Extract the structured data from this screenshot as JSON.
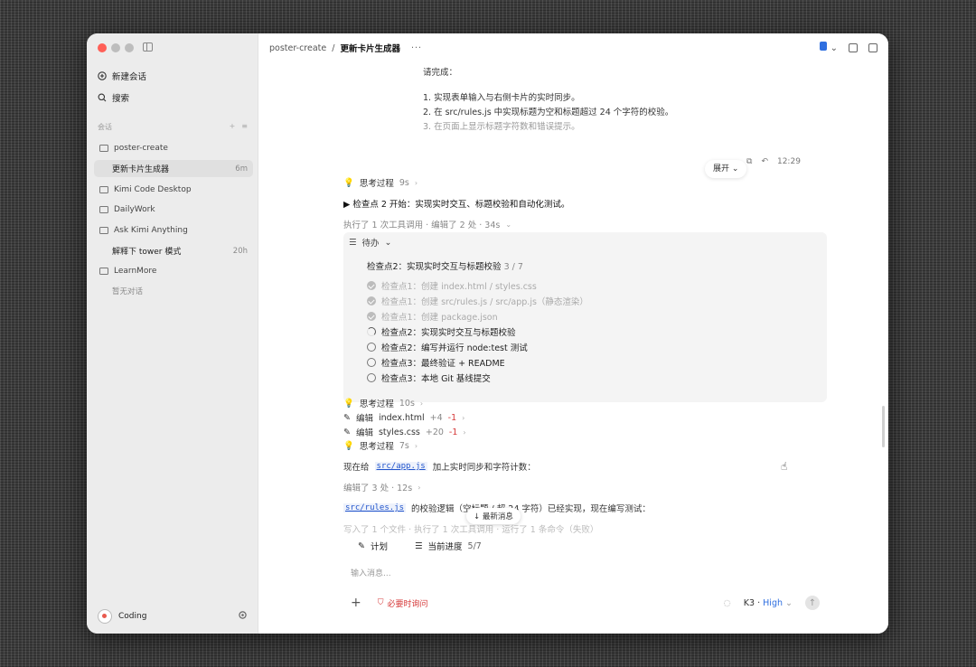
{
  "sidebar": {
    "new_chat": "新建会话",
    "search": "搜索",
    "section_label": "会话",
    "projects": [
      {
        "name": "poster-create",
        "chats": [
          {
            "title": "更新卡片生成器",
            "time": "6m",
            "active": true
          }
        ]
      },
      {
        "name": "Kimi Code Desktop",
        "chats": []
      },
      {
        "name": "DailyWork",
        "chats": []
      },
      {
        "name": "Ask Kimi Anything",
        "chats": [
          {
            "title": "解释下 tower 模式",
            "time": "20h",
            "active": false
          }
        ]
      },
      {
        "name": "LearnMore",
        "chats": [],
        "empty_text": "暂无对话"
      }
    ],
    "user": {
      "name": "Coding"
    }
  },
  "topbar": {
    "project": "poster-create",
    "separator": "/",
    "title": "更新卡片生成器",
    "more": "···"
  },
  "user_message": {
    "intro": "请完成：",
    "lines": [
      "1. 实现表单输入与右侧卡片的实时同步。",
      "2. 在 src/rules.js 中实现标题为空和标题超过 24 个字符的校验。",
      "3. 在页面上显示标题字符数和错误提示。"
    ],
    "expand": "展开",
    "time": "12:29"
  },
  "thinking_1": {
    "label": "思考过程",
    "duration": "9s"
  },
  "checkpoint_start": "▶ 检查点 2 开始：实现实时交互、标题校验和自动化测试。",
  "tool_summary": "执行了 1 次工具调用 · 编辑了 2 处 · 34s",
  "todo": {
    "header": "待办",
    "title": "检查点2：实现实时交互与标题校验",
    "progress": "3 / 7",
    "items": [
      {
        "text": "检查点1：创建 index.html / styles.css",
        "status": "done"
      },
      {
        "text": "检查点1：创建 src/rules.js / src/app.js（静态渲染）",
        "status": "done"
      },
      {
        "text": "检查点1：创建 package.json",
        "status": "done"
      },
      {
        "text": "检查点2：实现实时交互与标题校验",
        "status": "in_progress"
      },
      {
        "text": "检查点2：编写并运行 node:test 测试",
        "status": "todo"
      },
      {
        "text": "检查点3：最终验证 + README",
        "status": "todo"
      },
      {
        "text": "检查点3：本地 Git 基线提交",
        "status": "todo"
      }
    ]
  },
  "steps": [
    {
      "kind": "think",
      "label": "思考过程",
      "detail": "10s"
    },
    {
      "kind": "edit",
      "label": "编辑",
      "file": "index.html",
      "add": "+4",
      "del": "-1"
    },
    {
      "kind": "edit",
      "label": "编辑",
      "file": "styles.css",
      "add": "+20",
      "del": "-1"
    },
    {
      "kind": "think",
      "label": "思考过程",
      "detail": "7s"
    }
  ],
  "message_1": {
    "pre": "现在给",
    "code": "src/app.js",
    "post": "加上实时同步和字符计数："
  },
  "edit_summary": "编辑了 3 处 · 12s",
  "message_2": {
    "code": "src/rules.js",
    "post": "的校验逻辑（空标题 / 超 24 字符）已经实现，现在编写测试："
  },
  "message_3": "写入了 1 个文件 · 执行了 1 次工具调用 · 运行了 1 条命令（失败）",
  "new_message_btn": "↓ 最新消息",
  "plan_bar": {
    "plan": "计划",
    "progress_label": "当前进度",
    "progress": "5/7"
  },
  "composer": {
    "placeholder": "输入消息...",
    "must_ask": "必要时询问",
    "model": "K3",
    "separator": "·",
    "level": "High"
  },
  "colors": {
    "accent": "#2f6fe0",
    "danger": "#d63a3a",
    "sidebar_bg": "#ececec"
  }
}
